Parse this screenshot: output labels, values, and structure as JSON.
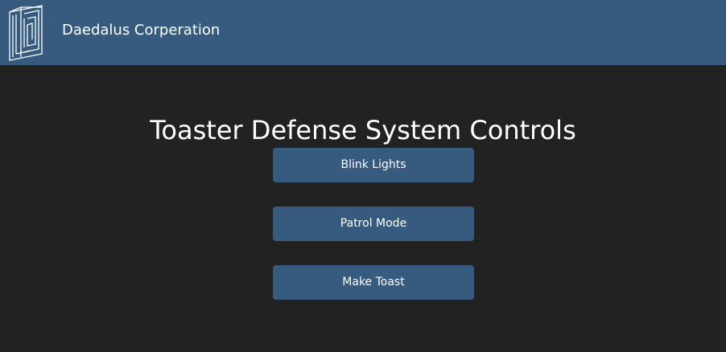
{
  "navbar": {
    "brand": "Daedalus Corperation",
    "logo_icon": "maze-logo-icon"
  },
  "main": {
    "title": "Toaster Defense System Controls",
    "buttons": [
      {
        "label": "Blink Lights"
      },
      {
        "label": "Patrol Mode"
      },
      {
        "label": "Make Toast"
      }
    ]
  },
  "colors": {
    "navbar_bg": "#375a7f",
    "page_bg": "#222222",
    "button_bg": "#375a7f",
    "text": "#ffffff"
  }
}
